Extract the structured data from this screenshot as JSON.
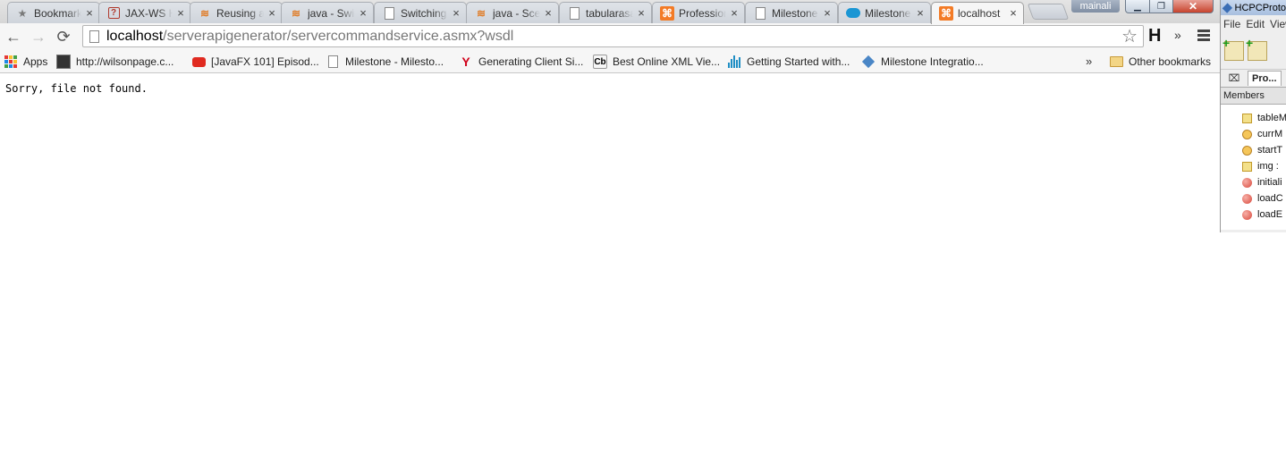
{
  "tabs": [
    {
      "title": "Bookmarks",
      "icon": "star-icon"
    },
    {
      "title": "JAX-WS Handler",
      "icon": "jax-icon"
    },
    {
      "title": "Reusing a",
      "icon": "stackoverflow-icon"
    },
    {
      "title": "java - Swing",
      "icon": "stackoverflow-icon"
    },
    {
      "title": "Switching",
      "icon": "document-icon"
    },
    {
      "title": "java - Scene",
      "icon": "stackoverflow-icon"
    },
    {
      "title": "tabularasa",
      "icon": "document-icon"
    },
    {
      "title": "Professional",
      "icon": "xampp-icon"
    },
    {
      "title": "Milestone",
      "icon": "document-icon"
    },
    {
      "title": "Milestone",
      "icon": "cloud-icon"
    },
    {
      "title": "localhost",
      "icon": "xampp-icon",
      "active": true
    }
  ],
  "tab_close_glyph": "×",
  "user_badge": "mainali",
  "window_controls": {
    "minimize": "▁",
    "maximize": "❐",
    "close": "✕"
  },
  "toolbar": {
    "back_glyph": "←",
    "forward_glyph": "→",
    "reload_glyph": "⟳",
    "url_host": "localhost",
    "url_path": "/serverapigenerator/servercommandservice.asmx?wsdl",
    "star_glyph": "☆",
    "extension_label": "H",
    "overflow_glyph": "»"
  },
  "bookmarks": {
    "items": [
      {
        "label": "Apps",
        "icon": "apps-icon"
      },
      {
        "label": "http://wilsonpage.c...",
        "icon": "photo-icon"
      },
      {
        "label": "[JavaFX 101] Episod...",
        "icon": "youtube-icon"
      },
      {
        "label": "Milestone - Milesto...",
        "icon": "document-icon"
      },
      {
        "label": "Generating Client Si...",
        "icon": "yahoo-icon"
      },
      {
        "label": "Best Online XML Vie...",
        "icon": "cb-icon"
      },
      {
        "label": "Getting Started with...",
        "icon": "bars-icon"
      },
      {
        "label": "Milestone Integratio...",
        "icon": "diamond-icon"
      }
    ],
    "chevron": "»",
    "other": "Other bookmarks",
    "cb_icon_text": "Cb",
    "yahoo_icon_text": "Y"
  },
  "page": {
    "message": "Sorry, file not found."
  },
  "ide": {
    "title": "HCPCProto",
    "menu": [
      "File",
      "Edit",
      "View"
    ],
    "tab_label": "Pro...",
    "close_glyph": "⌧",
    "members_header": "Members",
    "members": [
      {
        "label": "tableM",
        "kind": "field"
      },
      {
        "label": "currM",
        "kind": "private-field"
      },
      {
        "label": "startT",
        "kind": "private-field"
      },
      {
        "label": "img :",
        "kind": "field"
      },
      {
        "label": "initiali",
        "kind": "method"
      },
      {
        "label": "loadC",
        "kind": "method"
      },
      {
        "label": "loadE",
        "kind": "method"
      }
    ]
  },
  "colors": {
    "apps_grid": [
      "#e53935",
      "#fbc02d",
      "#43a047",
      "#1e88e5",
      "#e53935",
      "#fbc02d",
      "#43a047",
      "#1e88e5",
      "#e53935"
    ]
  }
}
